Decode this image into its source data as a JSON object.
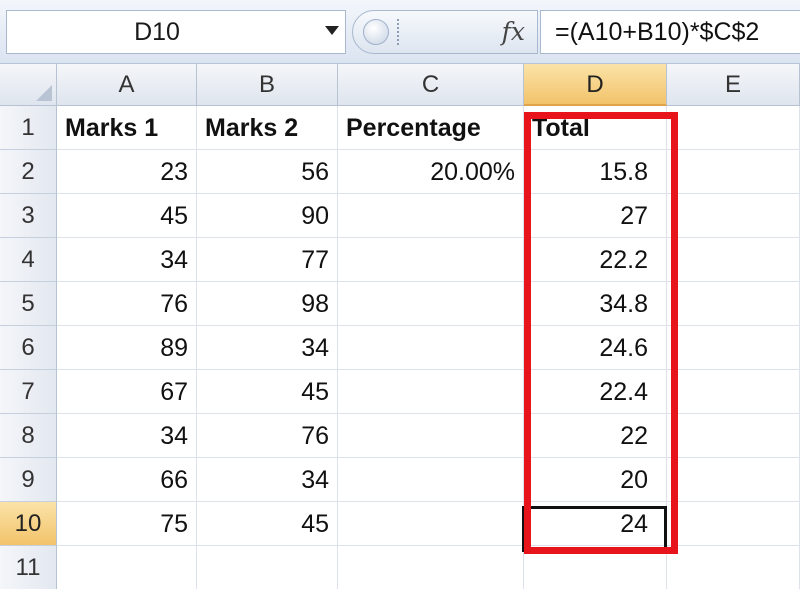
{
  "name_box": {
    "value": "D10"
  },
  "formula_bar": {
    "fx_label": "fx",
    "formula": "=(A10+B10)*$C$2"
  },
  "columns": [
    "A",
    "B",
    "C",
    "D",
    "E"
  ],
  "rows": [
    "1",
    "2",
    "3",
    "4",
    "5",
    "6",
    "7",
    "8",
    "9",
    "10",
    "11"
  ],
  "active_cell": {
    "column": "D",
    "row": "10"
  },
  "headers": {
    "a": "Marks 1",
    "b": "Marks 2",
    "c": "Percentage",
    "d": "Total"
  },
  "percentage_value": "20.00%",
  "data": [
    {
      "a": "23",
      "b": "56",
      "d": "15.8"
    },
    {
      "a": "45",
      "b": "90",
      "d": "27"
    },
    {
      "a": "34",
      "b": "77",
      "d": "22.2"
    },
    {
      "a": "76",
      "b": "98",
      "d": "34.8"
    },
    {
      "a": "89",
      "b": "34",
      "d": "24.6"
    },
    {
      "a": "67",
      "b": "45",
      "d": "22.4"
    },
    {
      "a": "34",
      "b": "76",
      "d": "22"
    },
    {
      "a": "66",
      "b": "34",
      "d": "20"
    },
    {
      "a": "75",
      "b": "45",
      "d": "24"
    }
  ],
  "colors": {
    "highlight": "#e8141c",
    "active_header": "#f2c36a"
  }
}
